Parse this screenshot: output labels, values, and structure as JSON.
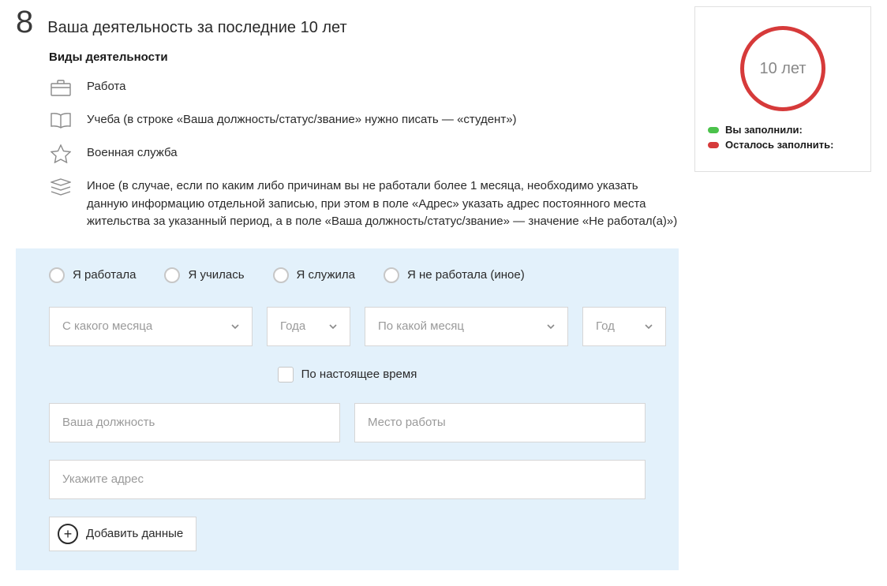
{
  "step": {
    "number": "8",
    "title": "Ваша деятельность за последние 10 лет"
  },
  "subheading": "Виды деятельности",
  "activities": [
    {
      "label": "Работа"
    },
    {
      "label": "Учеба (в строке «Ваша должность/статус/звание» нужно писать — «студент»)"
    },
    {
      "label": "Военная служба"
    },
    {
      "label": "Иное (в случае, если по каким либо причинам вы не работали более 1 месяца, необходимо указать данную информацию отдельной записью, при этом в поле «Адрес» указать адрес постоянного места жительства за указанный период, а в поле «Ваша должность/статус/звание» — значение «Не работал(а)»)"
    }
  ],
  "radios": {
    "worked": "Я работала",
    "studied": "Я училась",
    "served": "Я служила",
    "other": "Я не работала (иное)"
  },
  "selects": {
    "from_month": "С какого месяца",
    "from_year": "Года",
    "to_month": "По какой месяц",
    "to_year": "Год"
  },
  "present_checkbox": "По настоящее время",
  "inputs": {
    "position": "Ваша должность",
    "workplace": "Место работы",
    "address": "Укажите адрес"
  },
  "add_button": "Добавить данные",
  "sidebar": {
    "ring_label": "10 лет",
    "filled": "Вы заполнили:",
    "remaining": "Осталось заполнить:"
  }
}
